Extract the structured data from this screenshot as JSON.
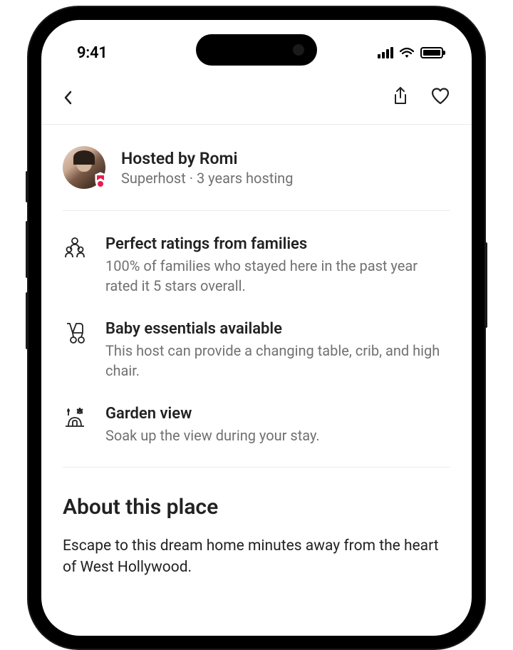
{
  "status": {
    "time": "9:41"
  },
  "host": {
    "title": "Hosted by Romi",
    "subtitle": "Superhost · 3 years hosting"
  },
  "highlights": [
    {
      "title": "Perfect ratings from families",
      "desc": "100% of families who stayed here in the past year rated it 5 stars overall."
    },
    {
      "title": "Baby essentials available",
      "desc": "This host can provide a changing table, crib, and high chair."
    },
    {
      "title": "Garden view",
      "desc": "Soak up the view during your stay."
    }
  ],
  "about": {
    "heading": "About this place",
    "text": "Escape to this dream home minutes away from the heart of West Hollywood."
  }
}
